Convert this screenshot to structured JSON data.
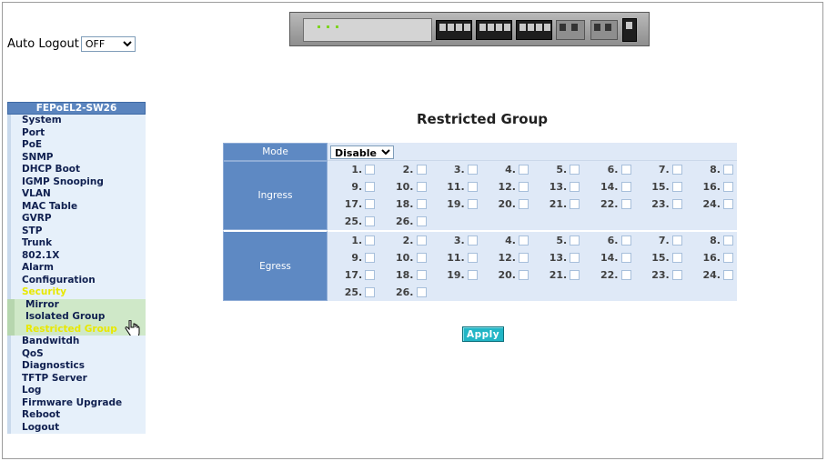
{
  "header": {
    "auto_logout_label": "Auto Logout",
    "auto_logout_value": "OFF"
  },
  "sidebar": {
    "title": "FEPoEL2-SW26",
    "items": [
      {
        "label": "System"
      },
      {
        "label": "Port"
      },
      {
        "label": "PoE"
      },
      {
        "label": "SNMP"
      },
      {
        "label": "DHCP Boot"
      },
      {
        "label": "IGMP Snooping"
      },
      {
        "label": "VLAN"
      },
      {
        "label": "MAC Table"
      },
      {
        "label": "GVRP"
      },
      {
        "label": "STP"
      },
      {
        "label": "Trunk"
      },
      {
        "label": "802.1X"
      },
      {
        "label": "Alarm"
      },
      {
        "label": "Configuration"
      },
      {
        "label": "Security",
        "active": true
      },
      {
        "label": "Mirror",
        "sub": true
      },
      {
        "label": "Isolated Group",
        "sub": true
      },
      {
        "label": "Restricted Group",
        "sub": true,
        "active": true
      },
      {
        "label": "Bandwitdh"
      },
      {
        "label": "QoS"
      },
      {
        "label": "Diagnostics"
      },
      {
        "label": "TFTP Server"
      },
      {
        "label": "Log"
      },
      {
        "label": "Firmware Upgrade"
      },
      {
        "label": "Reboot"
      },
      {
        "label": "Logout"
      }
    ]
  },
  "main": {
    "title": "Restricted Group",
    "mode_label": "Mode",
    "mode_value": "Disable",
    "ingress_label": "Ingress",
    "egress_label": "Egress",
    "ports": [
      "1.",
      "2.",
      "3.",
      "4.",
      "5.",
      "6.",
      "7.",
      "8.",
      "9.",
      "10.",
      "11.",
      "12.",
      "13.",
      "14.",
      "15.",
      "16.",
      "17.",
      "18.",
      "19.",
      "20.",
      "21.",
      "22.",
      "23.",
      "24.",
      "25.",
      "26."
    ],
    "apply_label": "Apply"
  },
  "colors": {
    "label_bg": "#5e89c3",
    "grid_bg": "#dfe9f7",
    "apply_bg": "#22b6c6",
    "active_menu": "#e8e800"
  }
}
